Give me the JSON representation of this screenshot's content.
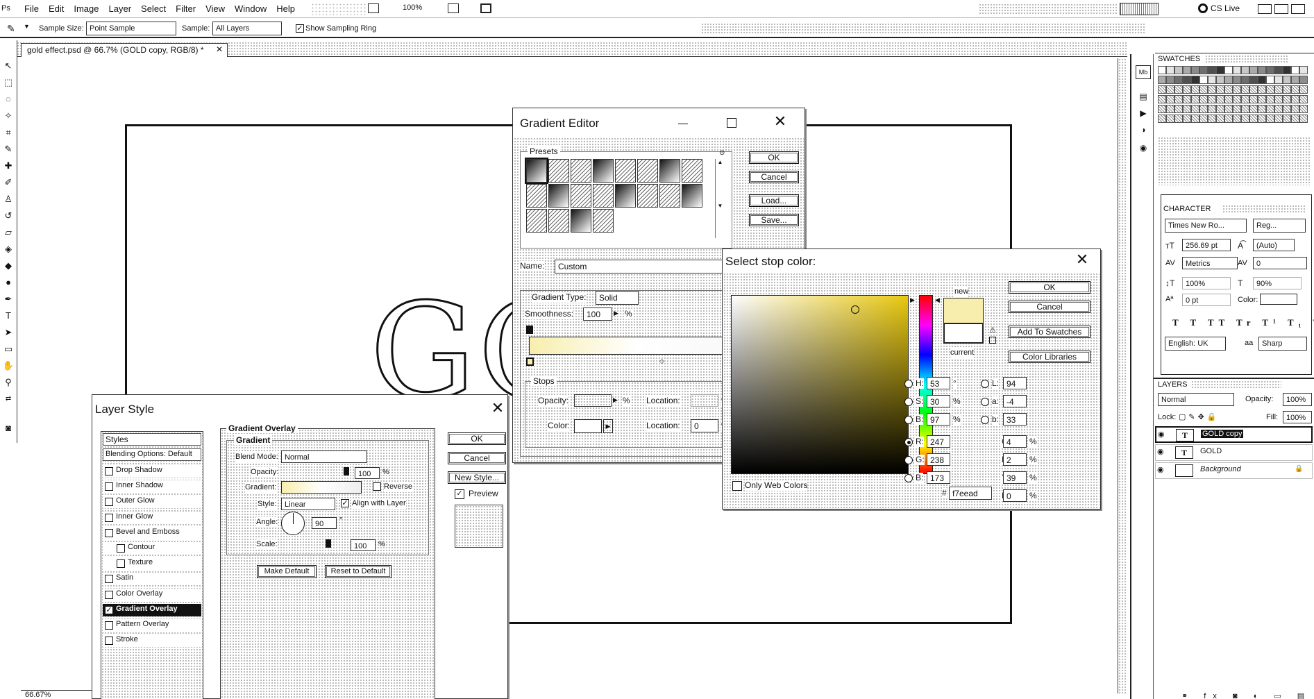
{
  "menubar": {
    "items": [
      "File",
      "Edit",
      "Image",
      "Layer",
      "Select",
      "Filter",
      "View",
      "Window",
      "Help"
    ],
    "zoom": "100%",
    "cslive": "CS Live"
  },
  "options": {
    "sample_size_label": "Sample Size:",
    "sample_size": "Point Sample",
    "sample_label": "Sample:",
    "sample": "All Layers",
    "ring": "Show Sampling Ring"
  },
  "doc": {
    "tab": "gold effect.psd @ 66.7% (GOLD copy, RGB/8) *",
    "zoom": "66.67%",
    "text": "GO"
  },
  "layer_style": {
    "title": "Layer Style",
    "styles_header": "Styles",
    "blending": "Blending Options: Default",
    "items": [
      {
        "label": "Drop Shadow",
        "checked": false,
        "indent": false,
        "active": false
      },
      {
        "label": "Inner Shadow",
        "checked": false,
        "indent": false,
        "active": false
      },
      {
        "label": "Outer Glow",
        "checked": false,
        "indent": false,
        "active": false
      },
      {
        "label": "Inner Glow",
        "checked": false,
        "indent": false,
        "active": false
      },
      {
        "label": "Bevel and Emboss",
        "checked": false,
        "indent": false,
        "active": false
      },
      {
        "label": "Contour",
        "checked": false,
        "indent": true,
        "active": false
      },
      {
        "label": "Texture",
        "checked": false,
        "indent": true,
        "active": false
      },
      {
        "label": "Satin",
        "checked": false,
        "indent": false,
        "active": false
      },
      {
        "label": "Color Overlay",
        "checked": false,
        "indent": false,
        "active": false
      },
      {
        "label": "Gradient Overlay",
        "checked": true,
        "indent": false,
        "active": true
      },
      {
        "label": "Pattern Overlay",
        "checked": false,
        "indent": false,
        "active": false
      },
      {
        "label": "Stroke",
        "checked": false,
        "indent": false,
        "active": false
      }
    ],
    "section": "Gradient Overlay",
    "group": "Gradient",
    "blend_label": "Blend Mode:",
    "blend": "Normal",
    "opacity_label": "Opacity:",
    "opacity": "100",
    "gradient_label": "Gradient:",
    "reverse": "Reverse",
    "style_label": "Style:",
    "style": "Linear",
    "align": "Align with Layer",
    "angle_label": "Angle:",
    "angle": "90",
    "scale_label": "Scale:",
    "scale": "100",
    "make_default": "Make Default",
    "reset_default": "Reset to Default",
    "ok": "OK",
    "cancel": "Cancel",
    "new_style": "New Style...",
    "preview": "Preview"
  },
  "gradient_editor": {
    "title": "Gradient Editor",
    "presets": "Presets",
    "ok": "OK",
    "cancel": "Cancel",
    "load": "Load...",
    "save": "Save...",
    "name_label": "Name:",
    "name": "Custom",
    "type_label": "Gradient Type:",
    "type": "Solid",
    "smooth_label": "Smoothness:",
    "smooth": "100",
    "stops": "Stops",
    "opacity_label": "Opacity:",
    "location_label": "Location:",
    "color_label": "Color:",
    "location2": "0",
    "pct": "%"
  },
  "color_picker": {
    "title": "Select stop color:",
    "ok": "OK",
    "cancel": "Cancel",
    "add": "Add To Swatches",
    "libraries": "Color Libraries",
    "new": "new",
    "current": "current",
    "web": "Only Web Colors",
    "H": "53",
    "S": "30",
    "B": "97",
    "R": "247",
    "G": "238",
    "B2": "173",
    "L": "94",
    "a": "-4",
    "b": "33",
    "C": "4",
    "M": "2",
    "Y": "39",
    "K": "0",
    "hex": "f7eead",
    "hex_color": "#f7eead"
  },
  "swatches": {
    "tab": "SWATCHES"
  },
  "character": {
    "tab": "CHARACTER",
    "font": "Times New Ro...",
    "weight": "Reg...",
    "size": "256.69 pt",
    "leading": "(Auto)",
    "kerning": "Metrics",
    "tracking": "0",
    "vscale": "100%",
    "hscale": "90%",
    "baseline": "0 pt",
    "color_label": "Color:",
    "lang": "English: UK",
    "aa_label": "aa",
    "aa": "Sharp"
  },
  "layers": {
    "tab": "LAYERS",
    "mode": "Normal",
    "opacity_label": "Opacity:",
    "opacity": "100%",
    "lock_label": "Lock:",
    "fill_label": "Fill:",
    "fill": "100%",
    "items": [
      {
        "name": "GOLD copy",
        "type": "T",
        "selected": true
      },
      {
        "name": "GOLD",
        "type": "T",
        "selected": false
      },
      {
        "name": "Background",
        "type": "img",
        "selected": false
      }
    ]
  }
}
